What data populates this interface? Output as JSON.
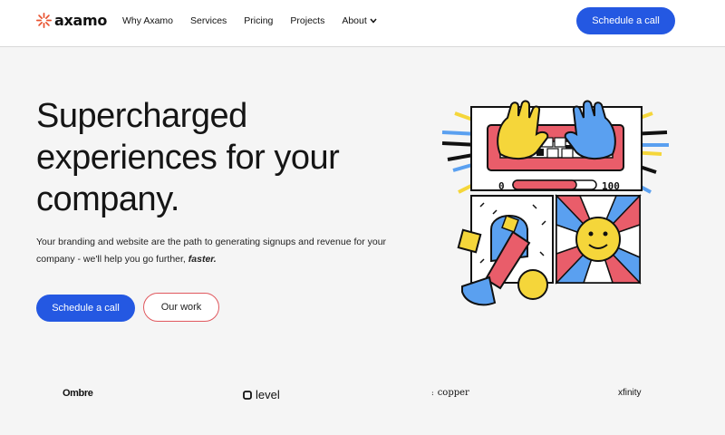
{
  "brand": {
    "name": "axamo",
    "accent": "#e8512e"
  },
  "nav": {
    "links": [
      "Why Axamo",
      "Services",
      "Pricing",
      "Projects",
      "About"
    ],
    "cta": "Schedule a call"
  },
  "hero": {
    "title": "Supercharged experiences for your company.",
    "subtitle_before": "Your branding and website are the path to generating signups and revenue for your company - we'll help you go further, ",
    "subtitle_emphasis": "faster.",
    "cta_primary": "Schedule a call",
    "cta_secondary": "Our work"
  },
  "illustration": {
    "slider_min": "0",
    "slider_max": "100"
  },
  "client_logos": [
    "Ombre",
    "level",
    "copper",
    "xfinity"
  ],
  "colors": {
    "primary": "#2458e2",
    "outline": "#e0585e",
    "red": "#e95d6a",
    "yellow": "#f5d63a",
    "blue": "#5aa0f0"
  }
}
